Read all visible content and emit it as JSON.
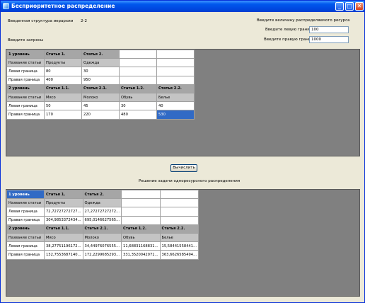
{
  "window": {
    "title": "Бесприоритетное распределение"
  },
  "titlebar_buttons": {
    "minimize": "_",
    "maximize": "□",
    "close": "✕"
  },
  "structure": {
    "label": "Введенная структура иерархии",
    "value": "2-2"
  },
  "resource": {
    "header": "Введите величину распределяемого ресурса",
    "left_label": "Введите левую границу",
    "left_value": "100",
    "right_label": "Введите правую границу",
    "right_value": "1000"
  },
  "requests_label": "Введите запросы",
  "input_grid": {
    "rows": [
      [
        "1 уровень",
        "Статья 1.",
        "Статья 2.",
        "",
        ""
      ],
      [
        "Название статьи",
        "Продукты",
        "Одежда",
        "",
        ""
      ],
      [
        "Левая граница",
        "80",
        "30",
        "",
        ""
      ],
      [
        "Правая граница",
        "400",
        "950",
        "",
        ""
      ],
      [
        "2 уровень",
        "Статья 1.1.",
        "Статья 2.1.",
        "Статья 1.2.",
        "Статья 2.2."
      ],
      [
        "Название статьи",
        "Мясо",
        "Молоко",
        "Обувь",
        "Белье"
      ],
      [
        "Левая граница",
        "50",
        "45",
        "30",
        "40"
      ],
      [
        "Правая граница",
        "170",
        "220",
        "480",
        "530"
      ]
    ]
  },
  "compute_button": "Вычислить",
  "solution_label": "Решение задачи одноресурсного распределения",
  "output_grid": {
    "rows": [
      [
        "1 уровень",
        "Статья 1.",
        "Статья 2.",
        "",
        ""
      ],
      [
        "Название статьи",
        "Продукты",
        "Одежда",
        "",
        ""
      ],
      [
        "Левая граница",
        "72,72727272727...",
        "27,27272727272...",
        "",
        ""
      ],
      [
        "Правая граница",
        "304,9853372434...",
        "695,0146627565...",
        "",
        ""
      ],
      [
        "2 уровень",
        "Статья 1.1.",
        "Статья 2.1.",
        "Статья 1.2.",
        "Статья 2.2."
      ],
      [
        "Название статьи",
        "Мясо",
        "Молоко",
        "Обувь",
        "Белье"
      ],
      [
        "Левая граница",
        "38,27751196172...",
        "34,44976076555...",
        "11,68831168831...",
        "15,58441558441..."
      ],
      [
        "Правая граница",
        "132,7553687140...",
        "172,2299685293...",
        "331,3520042071...",
        "363,6626585494..."
      ]
    ]
  }
}
